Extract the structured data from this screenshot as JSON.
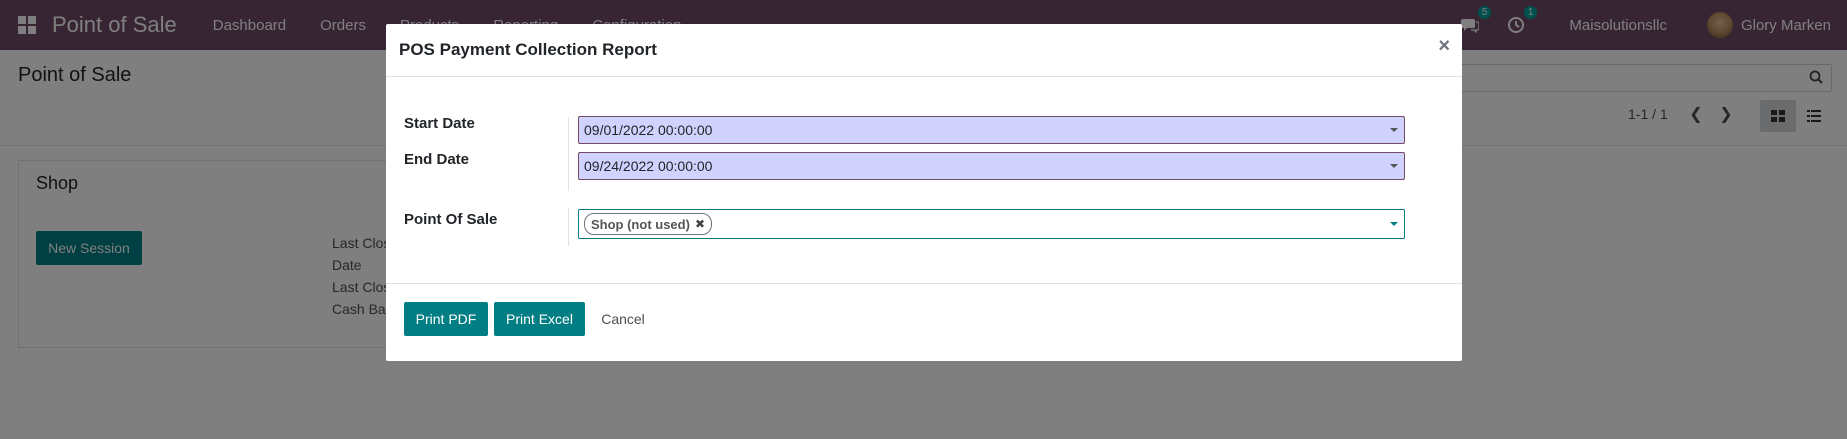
{
  "navbar": {
    "brand": "Point of Sale",
    "menu": [
      "Dashboard",
      "Orders",
      "Products",
      "Reporting",
      "Configuration"
    ],
    "messages_badge": "5",
    "activities_badge": "1",
    "company": "Maisolutionsllc",
    "user": "Glory Marken"
  },
  "control_panel": {
    "breadcrumb": "Point of Sale",
    "pager": "1-1 / 1"
  },
  "card": {
    "title": "Shop",
    "new_session": "New Session",
    "meta": [
      "Last Clos",
      "Date",
      "Last Clos",
      "Cash Ba"
    ]
  },
  "modal": {
    "title": "POS Payment Collection Report",
    "close": "×",
    "start_date_label": "Start Date",
    "start_date_value": "09/01/2022 00:00:00",
    "end_date_label": "End Date",
    "end_date_value": "09/24/2022 00:00:00",
    "pos_label": "Point Of Sale",
    "pos_tag": "Shop (not used)",
    "print_pdf": "Print PDF",
    "print_excel": "Print Excel",
    "cancel": "Cancel"
  },
  "colors": {
    "navbar": "#714B67",
    "primary": "#017E84",
    "date_input_bg": "#d2d2ff"
  }
}
